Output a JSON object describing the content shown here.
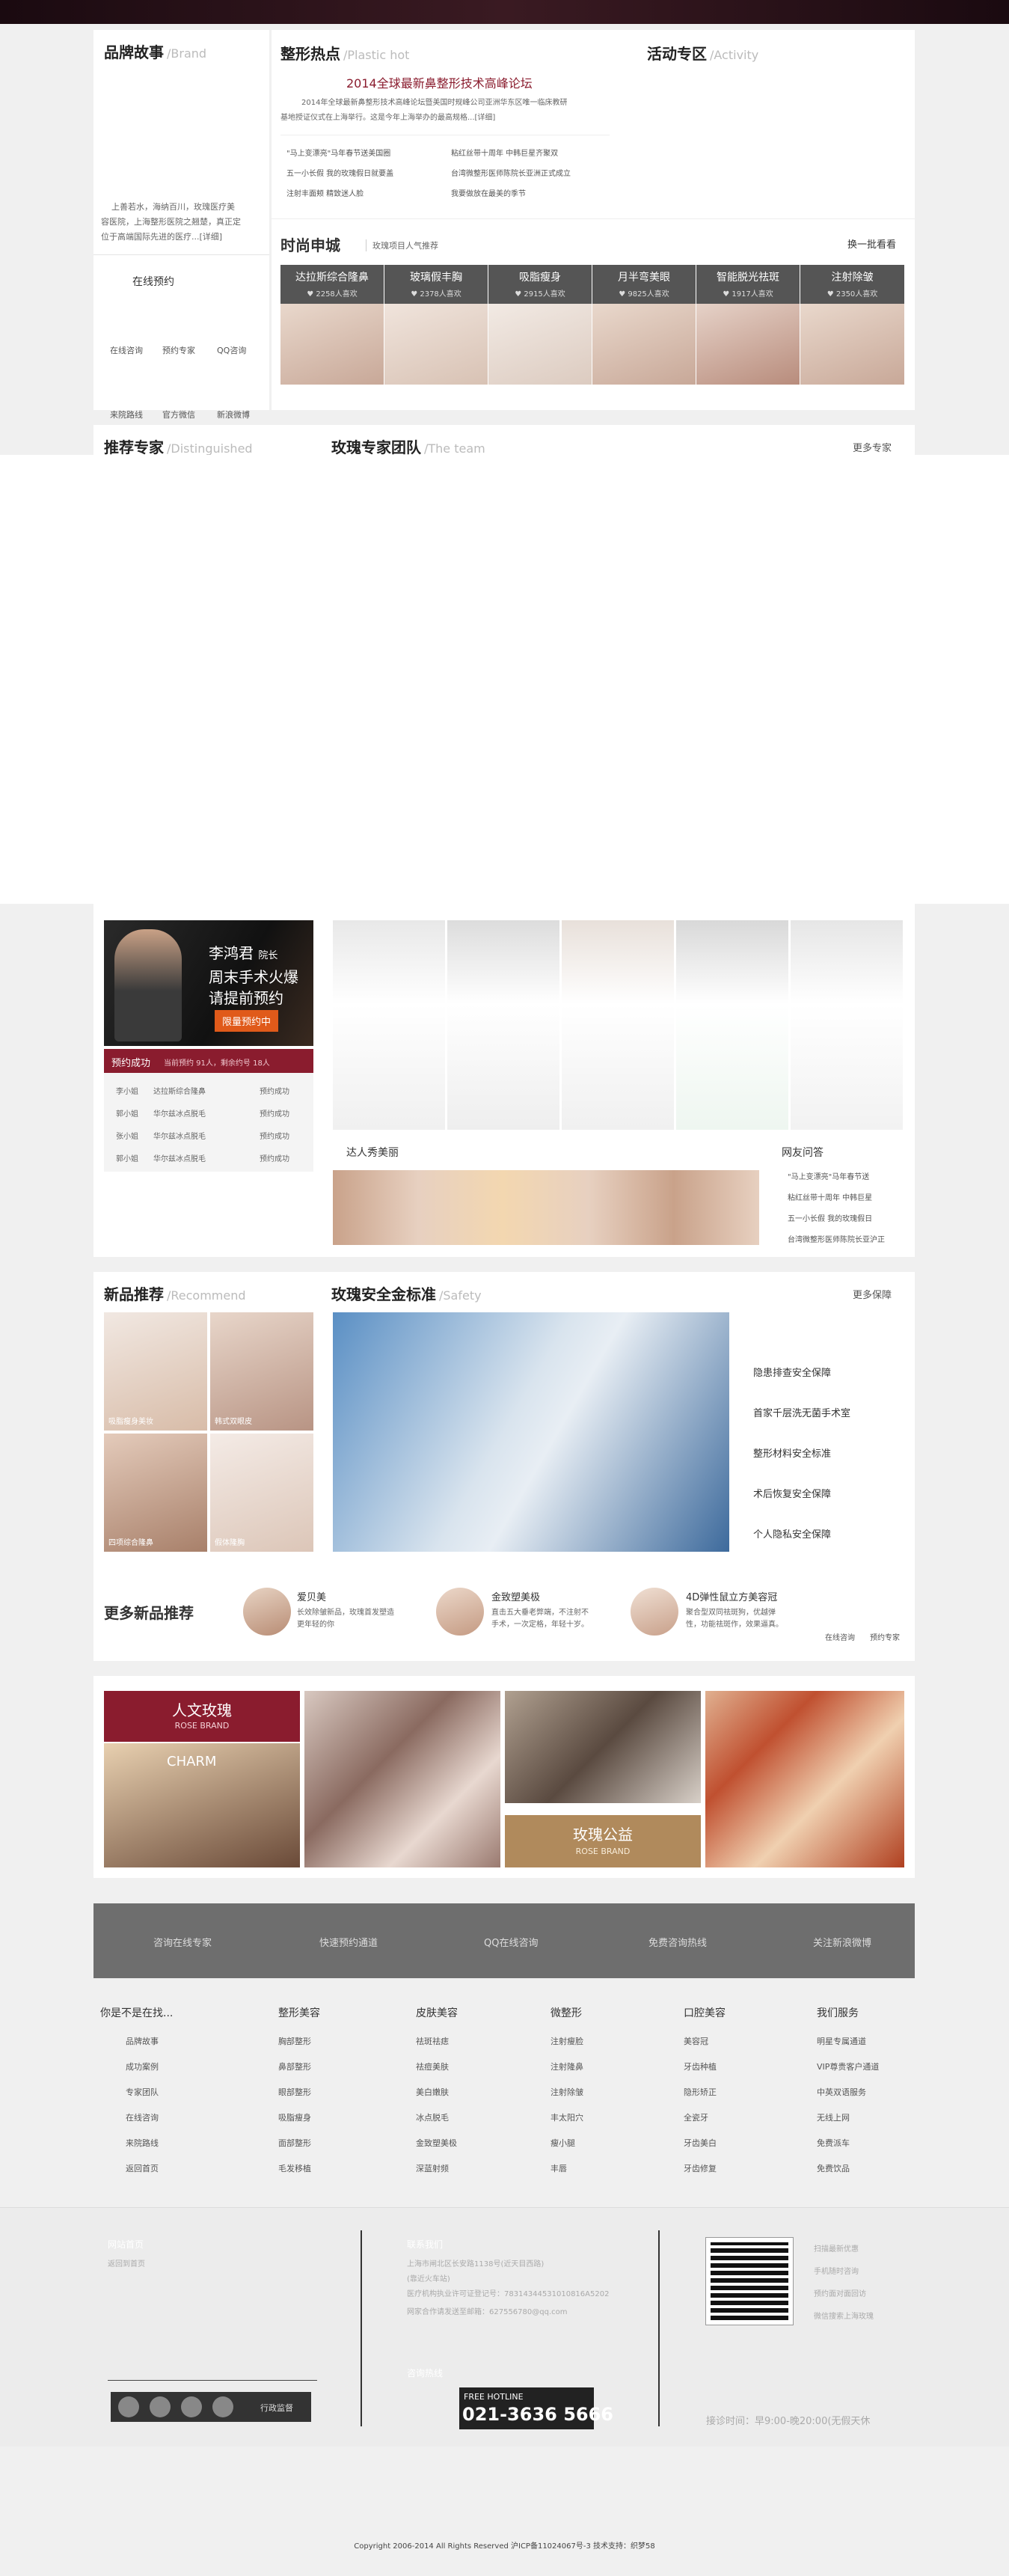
{
  "brand": {
    "title": "品牌故事",
    "en": "/Brand",
    "desc_line1": "上善若水，海纳百川，玫瑰医疗美",
    "desc_line2": "容医院，上海整形医院之翘楚，真正定",
    "desc_line3": "位于高端国际先进的医疗...[详细]",
    "booking": "在线预约",
    "links": [
      "在线咨询",
      "预约专家",
      "QQ咨询",
      "来院路线",
      "官方微信",
      "新浪微博"
    ]
  },
  "hot": {
    "title": "整形热点",
    "en": "/Plastic hot",
    "headline": "2014全球最新鼻整形技术高峰论坛",
    "summary1": "2014年全球最新鼻整形技术高峰论坛暨美国时规峰公司亚洲华东区唯一临床教研",
    "summary2": "基地授证仪式在上海举行。这是今年上海举办的最高规格...[详细]",
    "news": [
      "\"马上变漂亮\"马年春节送美国圈",
      "粘红丝带十周年 中韩巨星齐聚双",
      "五一小长假 我的玫瑰假日就要盖",
      "台湾微整形医师陈院长亚洲正式成立",
      "注射丰面颊 精致迷人脸",
      "我要做放在最美的季节"
    ]
  },
  "activity": {
    "title": "活动专区",
    "en": "/Activity"
  },
  "mall": {
    "title": "时尚申城",
    "sub": "玫瑰项目人气推荐",
    "more": "换一批看看",
    "tabs": [
      {
        "name": "达拉斯综合隆鼻",
        "count": "2258人喜欢"
      },
      {
        "name": "玻璃假丰胸",
        "count": "2378人喜欢"
      },
      {
        "name": "吸脂瘦身",
        "count": "2915人喜欢"
      },
      {
        "name": "月半弯美眼",
        "count": "9825人喜欢"
      },
      {
        "name": "智能脱光祛斑",
        "count": "1917人喜欢"
      },
      {
        "name": "注射除皱",
        "count": "2350人喜欢"
      }
    ]
  },
  "experts": {
    "title": "推荐专家",
    "en": "/Distinguished",
    "team_title": "玫瑰专家团队",
    "team_en": "/The team",
    "more": "更多专家",
    "promo_name": "李鸿君",
    "promo_role": "院长",
    "promo_line2": "周末手术火爆",
    "promo_line3": "请提前预约",
    "promo_btn": "限量预约中",
    "booked_label": "预约成功",
    "booked_stats": "当前预约 91人，剩余约号 18人",
    "rows": [
      {
        "n": "李小姐",
        "p": "达拉斯综合隆鼻",
        "s": "预约成功"
      },
      {
        "n": "郭小姐",
        "p": "华尔兹冰点脱毛",
        "s": "预约成功"
      },
      {
        "n": "张小姐",
        "p": "华尔兹冰点脱毛",
        "s": "预约成功"
      },
      {
        "n": "郭小姐",
        "p": "华尔兹冰点脱毛",
        "s": "预约成功"
      }
    ]
  },
  "show": {
    "title": "达人秀美丽",
    "qa_title": "网友问答",
    "qa": [
      "\"马上变漂亮\"马年春节送",
      "粘红丝带十周年 中韩巨星",
      "五一小长假 我的玫瑰假日",
      "台湾微整形医师陈院长亚沪正"
    ]
  },
  "recommend": {
    "title": "新品推荐",
    "en": "/Recommend",
    "captions": [
      "吸脂瘦身美妆",
      "韩式双眼皮",
      "四项综合隆鼻",
      "假体隆胸"
    ]
  },
  "safety": {
    "title": "玫瑰安全金标准",
    "en": "/Safety",
    "more": "更多保障",
    "items": [
      "隐患排查安全保障",
      "首家千层洗无菌手术室",
      "整形材料安全标准",
      "术后恢复安全保障",
      "个人隐私安全保障"
    ]
  },
  "more_new": {
    "title": "更多新品推荐",
    "items": [
      {
        "name": "爱贝美",
        "d1": "长效除皱新品，玫瑰首发塑造",
        "d2": "更年轻的你"
      },
      {
        "name": "金致塑美极",
        "d1": "直击五大垂老弊端，不注射不",
        "d2": "手术，一次定格，年轻十岁。"
      },
      {
        "name": "4D弹性鼠立方美容冠",
        "d1": "聚合型双同祛斑狗，优越弹",
        "d2": "性，功能祛斑作，效果逼真。"
      }
    ],
    "links": [
      "在线咨询",
      "预约专家"
    ]
  },
  "culture": {
    "left_title": "人文玫瑰",
    "left_en": "ROSE BRAND",
    "charm": "CHARM",
    "right_title": "玫瑰公益",
    "right_en": "ROSE BRAND"
  },
  "bar": [
    "咨询在线专家",
    "快速预约通道",
    "QQ在线咨询",
    "免费咨询热线",
    "关注新浪微博"
  ],
  "footer_cols": [
    {
      "title": "你是不是在找...",
      "items": [
        "品牌故事",
        "成功案例",
        "专家团队",
        "在线咨询",
        "来院路线",
        "返回首页"
      ]
    },
    {
      "title": "整形美容",
      "items": [
        "胸部整形",
        "鼻部整形",
        "眼部整形",
        "吸脂瘦身",
        "面部整形",
        "毛发移植"
      ]
    },
    {
      "title": "皮肤美容",
      "items": [
        "祛斑祛痣",
        "祛痘美肤",
        "美白嫩肤",
        "冰点脱毛",
        "金致塑美极",
        "深蓝射频"
      ]
    },
    {
      "title": "微整形",
      "items": [
        "注射瘦脸",
        "注射隆鼻",
        "注射除皱",
        "丰太阳穴",
        "瘦小腿",
        "丰唇"
      ]
    },
    {
      "title": "口腔美容",
      "items": [
        "美容冠",
        "牙齿种植",
        "隐形矫正",
        "全瓷牙",
        "牙齿美白",
        "牙齿修复"
      ]
    },
    {
      "title": "我们服务",
      "items": [
        "明星专属通道",
        "VIP尊贵客户通道",
        "中英双语服务",
        "无线上网",
        "免费派车",
        "免费饮品"
      ]
    }
  ],
  "info": {
    "website": "网站首页",
    "site_map": "返回到首页",
    "contact_title": "联系我们",
    "address": "上海市闸北区长安路1138号(近天目西路)",
    "near": "(靠近火车站)",
    "license": "医疗机构执业许可证登记号：78314344531010816A5202",
    "email": "网家合作请发送至邮箱：627556780@qq.com",
    "hotline_title": "咨询热线",
    "hotline_label": "FREE HOTLINE",
    "hotline": "021-3636 5666",
    "qr_links": [
      "扫描最新优惠",
      "手机随时咨询",
      "预约面对面回访",
      "微信搜索上海玫瑰"
    ],
    "hours": "接诊时间：早9:00-晚20:00(无假天休",
    "badge": "行政监督"
  },
  "copyright": "Copyright 2006-2014 All Rights Reserved 沪ICP备11024067号-3 技术支持：织梦58"
}
